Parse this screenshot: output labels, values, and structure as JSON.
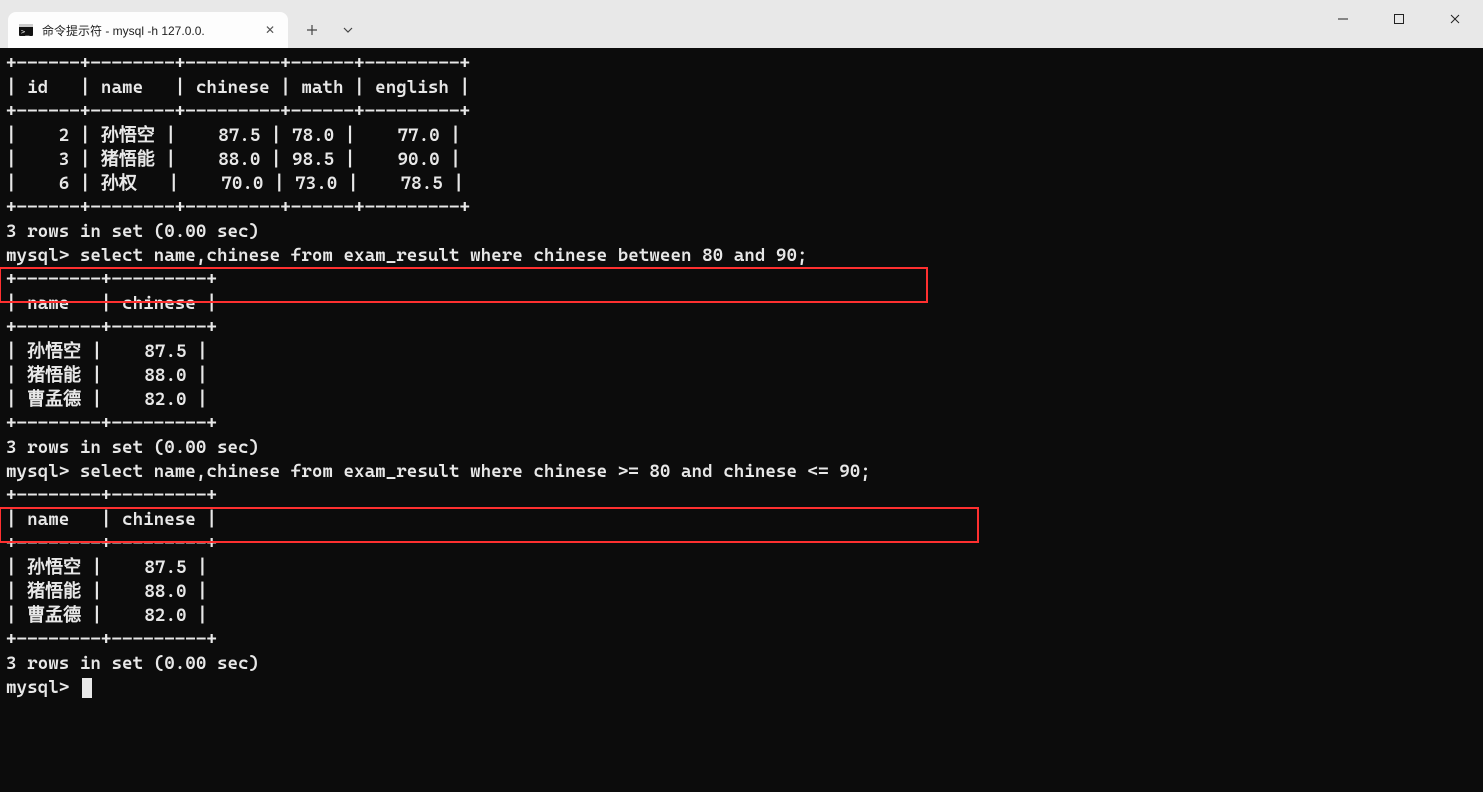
{
  "window": {
    "tab_title": "命令提示符 - mysql  -h 127.0.0.",
    "new_tab_label": "+",
    "dropdown_label": "v",
    "minimize": "—",
    "maximize": "▢",
    "close": "✕"
  },
  "terminal": {
    "table1_sep": "+------+--------+---------+------+---------+",
    "table1_head": "| id   | name   | chinese | math | english |",
    "table1_row1": "|    2 | 孙悟空 |    87.5 | 78.0 |    77.0 |",
    "table1_row2": "|    3 | 猪悟能 |    88.0 | 98.5 |    90.0 |",
    "table1_row3": "|    6 | 孙权   |    70.0 | 73.0 |    78.5 |",
    "rows1": "3 rows in set (0.00 sec)",
    "blank": "",
    "query1": "mysql> select name,chinese from exam_result where chinese between 80 and 90;",
    "table2_sep": "+--------+---------+",
    "table2_head": "| name   | chinese |",
    "table2_row1": "| 孙悟空 |    87.5 |",
    "table2_row2": "| 猪悟能 |    88.0 |",
    "table2_row3": "| 曹孟德 |    82.0 |",
    "rows2": "3 rows in set (0.00 sec)",
    "query2": "mysql> select name,chinese from exam_result where chinese >= 80 and chinese <= 90;",
    "table3_sep": "+--------+---------+",
    "table3_head": "| name   | chinese |",
    "table3_row1": "| 孙悟空 |    87.5 |",
    "table3_row2": "| 猪悟能 |    88.0 |",
    "table3_row3": "| 曹孟德 |    82.0 |",
    "rows3": "3 rows in set (0.00 sec)",
    "prompt": "mysql> "
  }
}
